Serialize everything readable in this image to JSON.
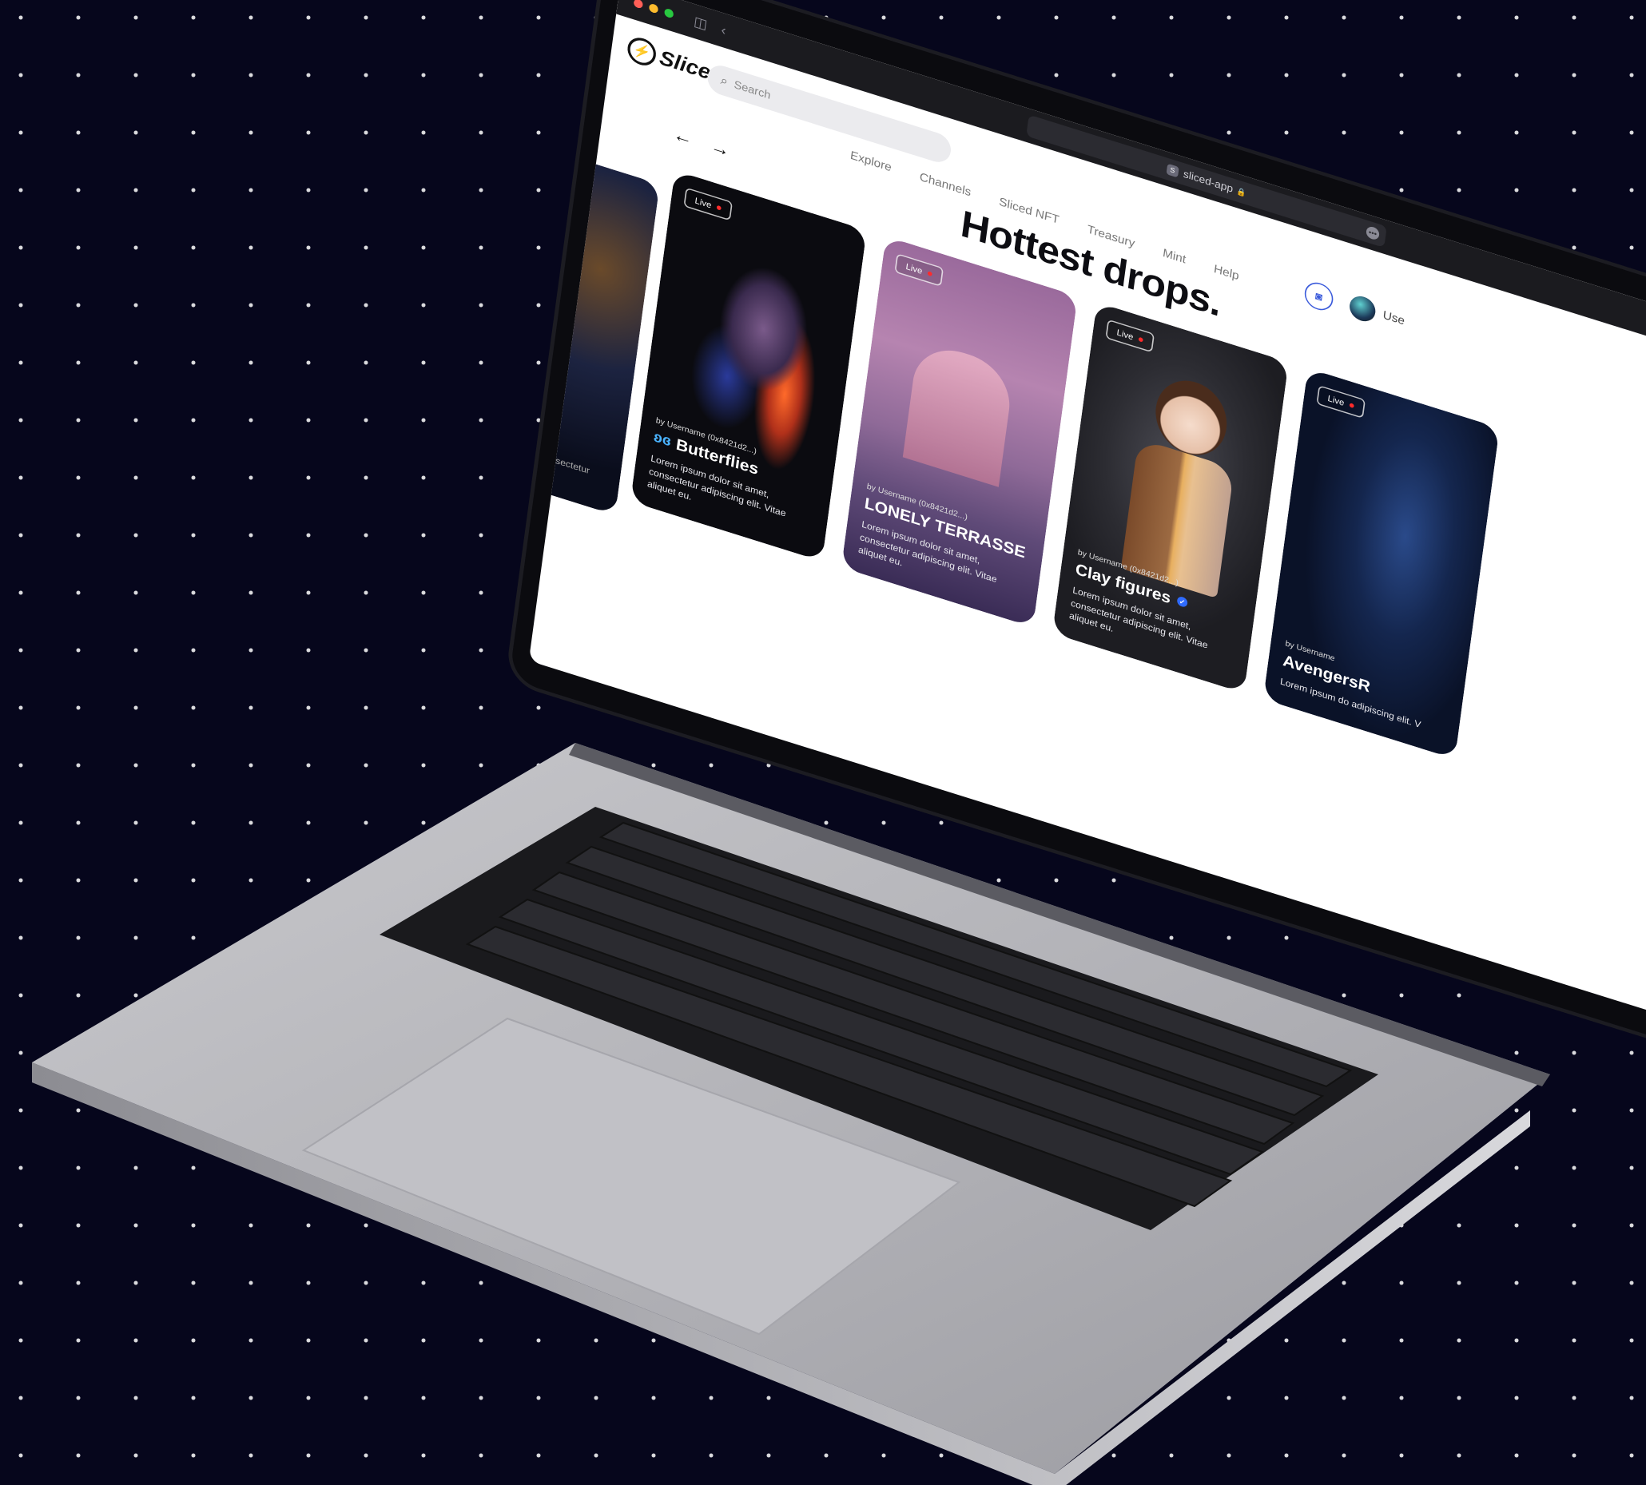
{
  "browser": {
    "url": "sliced-app",
    "url_badge": "S",
    "url_lock": "🔒",
    "traffic_lights": [
      "#ff5f57",
      "#febc2e",
      "#28c840"
    ],
    "sidebar_icon": "◫",
    "back_icon": "‹"
  },
  "header": {
    "logo_text": "Sliced",
    "logo_mark": "⚡",
    "logo_tm": "™",
    "search_placeholder": "Search",
    "search_icon": "⌕",
    "wallet_icon": "◙",
    "user_label": "Use"
  },
  "nav": [
    "Explore",
    "Channels",
    "Sliced NFT",
    "Treasury",
    "Mint",
    "Help"
  ],
  "page": {
    "headline": "Hottest drops.",
    "arrow_prev": "←",
    "arrow_next": "→"
  },
  "cards": [
    {
      "creator": "",
      "title": "",
      "desc": "met, consectetur\nuet eu.",
      "live": ""
    },
    {
      "live": "Live",
      "creator": "by Username (0x8421d2...)",
      "title": "Butterflies",
      "desc": "Lorem ipsum dolor sit amet, consectetur adipiscing elit. Vitae aliquet eu."
    },
    {
      "live": "Live",
      "creator": "by Username (0x8421d2...)",
      "title": "LONELY TERRASSE",
      "desc": "Lorem ipsum dolor sit amet, consectetur adipiscing elit. Vitae aliquet eu."
    },
    {
      "live": "Live",
      "creator": "by Username (0x8421d2...)",
      "title": "Clay figures",
      "desc": "Lorem ipsum dolor sit amet, consectetur adipiscing elit. Vitae aliquet eu."
    },
    {
      "live": "Live",
      "creator": "by Username",
      "title": "AvengersR",
      "desc": "Lorem ipsum do adipiscing elit. V"
    }
  ],
  "colors": {
    "background": "#06061c",
    "accent": "#3b5bdb",
    "live_dot": "#ff2b2b",
    "verified": "#2f6bff"
  }
}
